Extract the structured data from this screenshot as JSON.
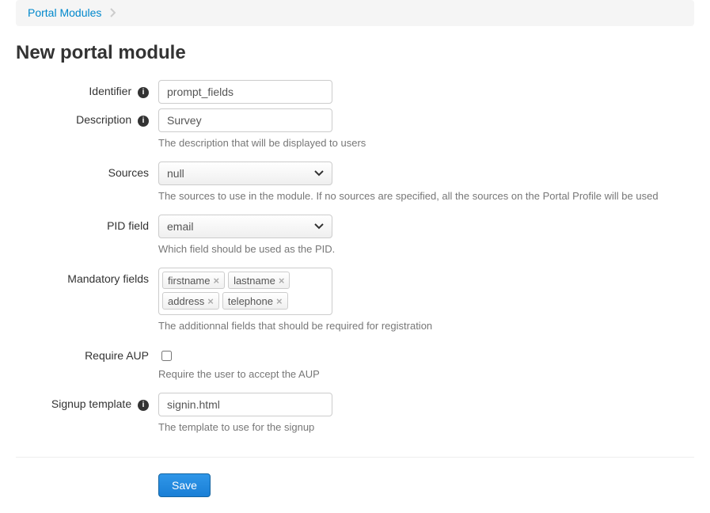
{
  "breadcrumb": {
    "link_text": "Portal Modules"
  },
  "page_title": "New portal module",
  "form": {
    "identifier": {
      "label": "Identifier",
      "value": "prompt_fields"
    },
    "description": {
      "label": "Description",
      "value": "Survey",
      "help": "The description that will be displayed to users"
    },
    "sources": {
      "label": "Sources",
      "value": "null",
      "help": "The sources to use in the module. If no sources are specified, all the sources on the Portal Profile will be used"
    },
    "pid_field": {
      "label": "PID field",
      "value": "email",
      "help": "Which field should be used as the PID."
    },
    "mandatory_fields": {
      "label": "Mandatory fields",
      "tags": [
        "firstname",
        "lastname",
        "address",
        "telephone"
      ],
      "help": "The additionnal fields that should be required for registration"
    },
    "require_aup": {
      "label": "Require AUP",
      "checked": false,
      "help": "Require the user to accept the AUP"
    },
    "signup_template": {
      "label": "Signup template",
      "value": "signin.html",
      "help": "The template to use for the signup"
    }
  },
  "buttons": {
    "save": "Save"
  }
}
